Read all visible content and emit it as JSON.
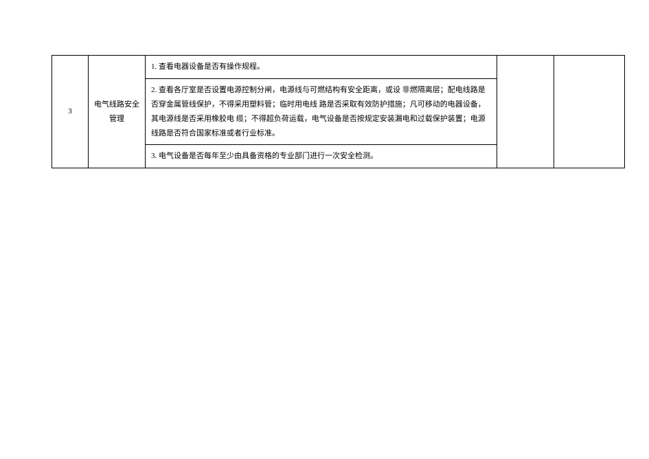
{
  "row": {
    "number": "3",
    "category": "电气线路安全管理",
    "items": [
      "1.  查看电器设备是否有操作规程。",
      "2.  查看各厅室是否设置电源控制分闸，电源线与可燃结构有安全距离，或设  非燃隔离层；配电线路是否穿金属管线保护，不得采用塑料管；临时用电线  路是否采取有效防护措施；凡可移动的电器设备，其电源线是否采用橡胶电  缆；不得超负荷运载，电气设备是否按规定安装漏电和过载保护装置；电源  线路是否符合国家标准或者行业标准。",
      "3.  电气设备是否每年至少由具备资格的专业部门进行一次安全检测。"
    ],
    "blank1": "",
    "blank2": ""
  }
}
